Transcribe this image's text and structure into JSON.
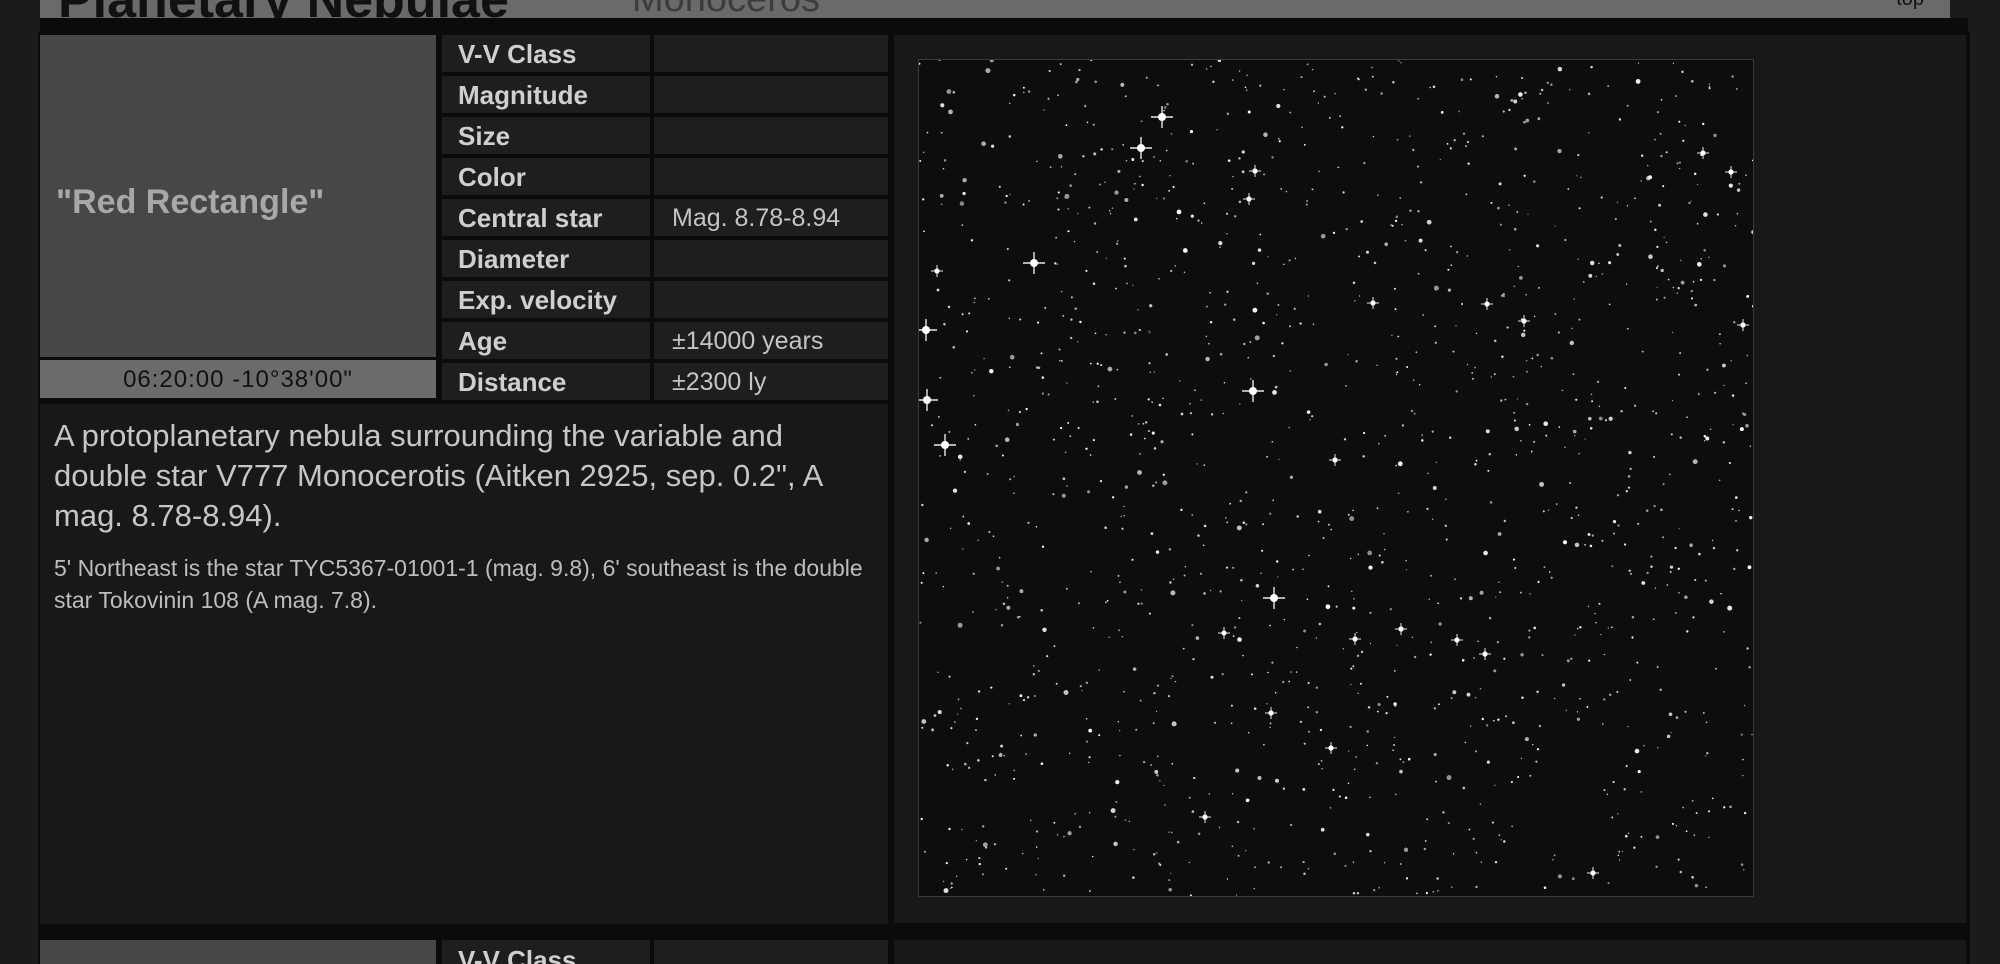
{
  "header": {
    "title": "Planetary Nebulae",
    "subtitle": "Monoceros",
    "link": "top"
  },
  "entry": {
    "name": "\"Red Rectangle\"",
    "coordinates": "06:20:00 -10°38'00\"",
    "properties": [
      {
        "label": "V-V Class",
        "value": ""
      },
      {
        "label": "Magnitude",
        "value": ""
      },
      {
        "label": "Size",
        "value": ""
      },
      {
        "label": "Color",
        "value": ""
      },
      {
        "label": "Central star",
        "value": "Mag. 8.78-8.94"
      },
      {
        "label": "Diameter",
        "value": ""
      },
      {
        "label": "Exp. velocity",
        "value": ""
      },
      {
        "label": "Age",
        "value": "±14000 years"
      },
      {
        "label": "Distance",
        "value": "±2300 ly"
      }
    ],
    "description": "A protoplanetary nebula surrounding the variable and double star V777 Monocerotis (Aitken 2925, sep. 0.2\", A mag. 8.78-8.94).",
    "notes": "5' Northeast is the star TYC5367-01001-1 (mag. 9.8), 6' southeast is the double star Tokovinin 108 (A mag. 7.8)."
  },
  "next_entry": {
    "first_property_label": "V-V Class"
  },
  "colors": {
    "page_background": "#1b1b1b",
    "panel_background": "#181818",
    "thumbnail": "#474747",
    "coordinate_bar": "#6b6b6b",
    "sky": "#0d0d0d"
  }
}
